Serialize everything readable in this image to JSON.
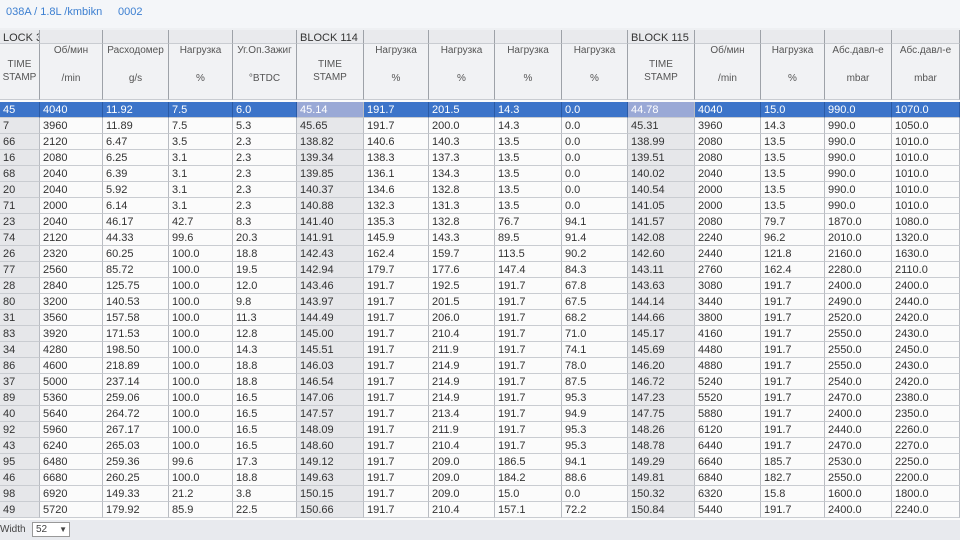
{
  "window": {
    "title": "038A / 1.8L /kmbikn",
    "code": "0002"
  },
  "blocks": {
    "b1": "LOCK 3",
    "b2": "BLOCK 114",
    "b3": "BLOCK 115"
  },
  "headers": [
    {
      "top": "",
      "bottom": "TIME\nSTAMP"
    },
    {
      "top": "Об/мин",
      "bottom": "/min"
    },
    {
      "top": "Расходомер",
      "bottom": "g/s"
    },
    {
      "top": "Нагрузка",
      "bottom": "%"
    },
    {
      "top": "Уг.Оп.Зажиг",
      "bottom": "°BTDC"
    },
    {
      "top": "",
      "bottom": "TIME\nSTAMP"
    },
    {
      "top": "Нагрузка",
      "bottom": "%"
    },
    {
      "top": "Нагрузка",
      "bottom": "%"
    },
    {
      "top": "Нагрузка",
      "bottom": "%"
    },
    {
      "top": "Нагрузка",
      "bottom": "%"
    },
    {
      "top": "",
      "bottom": "TIME\nSTAMP"
    },
    {
      "top": "Об/мин",
      "bottom": "/min"
    },
    {
      "top": "Нагрузка",
      "bottom": "%"
    },
    {
      "top": "Абс.давл-е",
      "bottom": "mbar"
    },
    {
      "top": "Абс.давл-е",
      "bottom": "mbar"
    }
  ],
  "rows": [
    [
      "45",
      "4040",
      "11.92",
      "7.5",
      "6.0",
      "45.14",
      "191.7",
      "201.5",
      "14.3",
      "0.0",
      "44.78",
      "4040",
      "15.0",
      "990.0",
      "1070.0"
    ],
    [
      "7",
      "3960",
      "11.89",
      "7.5",
      "5.3",
      "45.65",
      "191.7",
      "200.0",
      "14.3",
      "0.0",
      "45.31",
      "3960",
      "14.3",
      "990.0",
      "1050.0"
    ],
    [
      "66",
      "2120",
      "6.47",
      "3.5",
      "2.3",
      "138.82",
      "140.6",
      "140.3",
      "13.5",
      "0.0",
      "138.99",
      "2080",
      "13.5",
      "990.0",
      "1010.0"
    ],
    [
      "16",
      "2080",
      "6.25",
      "3.1",
      "2.3",
      "139.34",
      "138.3",
      "137.3",
      "13.5",
      "0.0",
      "139.51",
      "2080",
      "13.5",
      "990.0",
      "1010.0"
    ],
    [
      "68",
      "2040",
      "6.39",
      "3.1",
      "2.3",
      "139.85",
      "136.1",
      "134.3",
      "13.5",
      "0.0",
      "140.02",
      "2040",
      "13.5",
      "990.0",
      "1010.0"
    ],
    [
      "20",
      "2040",
      "5.92",
      "3.1",
      "2.3",
      "140.37",
      "134.6",
      "132.8",
      "13.5",
      "0.0",
      "140.54",
      "2000",
      "13.5",
      "990.0",
      "1010.0"
    ],
    [
      "71",
      "2000",
      "6.14",
      "3.1",
      "2.3",
      "140.88",
      "132.3",
      "131.3",
      "13.5",
      "0.0",
      "141.05",
      "2000",
      "13.5",
      "990.0",
      "1010.0"
    ],
    [
      "23",
      "2040",
      "46.17",
      "42.7",
      "8.3",
      "141.40",
      "135.3",
      "132.8",
      "76.7",
      "94.1",
      "141.57",
      "2080",
      "79.7",
      "1870.0",
      "1080.0"
    ],
    [
      "74",
      "2120",
      "44.33",
      "99.6",
      "20.3",
      "141.91",
      "145.9",
      "143.3",
      "89.5",
      "91.4",
      "142.08",
      "2240",
      "96.2",
      "2010.0",
      "1320.0"
    ],
    [
      "26",
      "2320",
      "60.25",
      "100.0",
      "18.8",
      "142.43",
      "162.4",
      "159.7",
      "113.5",
      "90.2",
      "142.60",
      "2440",
      "121.8",
      "2160.0",
      "1630.0"
    ],
    [
      "77",
      "2560",
      "85.72",
      "100.0",
      "19.5",
      "142.94",
      "179.7",
      "177.6",
      "147.4",
      "84.3",
      "143.11",
      "2760",
      "162.4",
      "2280.0",
      "2110.0"
    ],
    [
      "28",
      "2840",
      "125.75",
      "100.0",
      "12.0",
      "143.46",
      "191.7",
      "192.5",
      "191.7",
      "67.8",
      "143.63",
      "3080",
      "191.7",
      "2400.0",
      "2400.0"
    ],
    [
      "80",
      "3200",
      "140.53",
      "100.0",
      "9.8",
      "143.97",
      "191.7",
      "201.5",
      "191.7",
      "67.5",
      "144.14",
      "3440",
      "191.7",
      "2490.0",
      "2440.0"
    ],
    [
      "31",
      "3560",
      "157.58",
      "100.0",
      "11.3",
      "144.49",
      "191.7",
      "206.0",
      "191.7",
      "68.2",
      "144.66",
      "3800",
      "191.7",
      "2520.0",
      "2420.0"
    ],
    [
      "83",
      "3920",
      "171.53",
      "100.0",
      "12.8",
      "145.00",
      "191.7",
      "210.4",
      "191.7",
      "71.0",
      "145.17",
      "4160",
      "191.7",
      "2550.0",
      "2430.0"
    ],
    [
      "34",
      "4280",
      "198.50",
      "100.0",
      "14.3",
      "145.51",
      "191.7",
      "211.9",
      "191.7",
      "74.1",
      "145.69",
      "4480",
      "191.7",
      "2550.0",
      "2450.0"
    ],
    [
      "86",
      "4600",
      "218.89",
      "100.0",
      "18.8",
      "146.03",
      "191.7",
      "214.9",
      "191.7",
      "78.0",
      "146.20",
      "4880",
      "191.7",
      "2550.0",
      "2430.0"
    ],
    [
      "37",
      "5000",
      "237.14",
      "100.0",
      "18.8",
      "146.54",
      "191.7",
      "214.9",
      "191.7",
      "87.5",
      "146.72",
      "5240",
      "191.7",
      "2540.0",
      "2420.0"
    ],
    [
      "89",
      "5360",
      "259.06",
      "100.0",
      "16.5",
      "147.06",
      "191.7",
      "214.9",
      "191.7",
      "95.3",
      "147.23",
      "5520",
      "191.7",
      "2470.0",
      "2380.0"
    ],
    [
      "40",
      "5640",
      "264.72",
      "100.0",
      "16.5",
      "147.57",
      "191.7",
      "213.4",
      "191.7",
      "94.9",
      "147.75",
      "5880",
      "191.7",
      "2400.0",
      "2350.0"
    ],
    [
      "92",
      "5960",
      "267.17",
      "100.0",
      "16.5",
      "148.09",
      "191.7",
      "211.9",
      "191.7",
      "95.3",
      "148.26",
      "6120",
      "191.7",
      "2440.0",
      "2260.0"
    ],
    [
      "43",
      "6240",
      "265.03",
      "100.0",
      "16.5",
      "148.60",
      "191.7",
      "210.4",
      "191.7",
      "95.3",
      "148.78",
      "6440",
      "191.7",
      "2470.0",
      "2270.0"
    ],
    [
      "95",
      "6480",
      "259.36",
      "99.6",
      "17.3",
      "149.12",
      "191.7",
      "209.0",
      "186.5",
      "94.1",
      "149.29",
      "6640",
      "185.7",
      "2530.0",
      "2250.0"
    ],
    [
      "46",
      "6680",
      "260.25",
      "100.0",
      "18.8",
      "149.63",
      "191.7",
      "209.0",
      "184.2",
      "88.6",
      "149.81",
      "6840",
      "182.7",
      "2550.0",
      "2200.0"
    ],
    [
      "98",
      "6920",
      "149.33",
      "21.2",
      "3.8",
      "150.15",
      "191.7",
      "209.0",
      "15.0",
      "0.0",
      "150.32",
      "6320",
      "15.8",
      "1600.0",
      "1800.0"
    ],
    [
      "49",
      "5720",
      "179.92",
      "85.9",
      "22.5",
      "150.66",
      "191.7",
      "210.4",
      "157.1",
      "72.2",
      "150.84",
      "5440",
      "191.7",
      "2400.0",
      "2240.0"
    ]
  ],
  "footer": {
    "label": "Width",
    "value": "52"
  }
}
